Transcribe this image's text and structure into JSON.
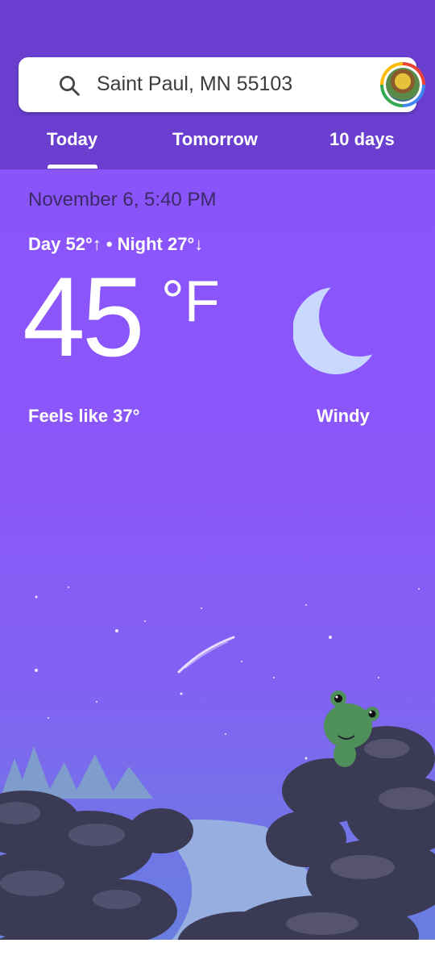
{
  "search": {
    "location": "Saint Paul, MN 55103",
    "icon": "search-icon"
  },
  "avatar": {
    "icon": "account-avatar"
  },
  "tabs": [
    {
      "label": "Today",
      "selected": true
    },
    {
      "label": "Tomorrow",
      "selected": false
    },
    {
      "label": "10 days",
      "selected": false
    }
  ],
  "weather": {
    "datetime": "November 6, 5:40 PM",
    "day_night": "Day 52°↑ • Night 27°↓",
    "temperature": "45",
    "unit": "°F",
    "feels_like": "Feels like 37°",
    "condition": "Windy",
    "condition_icon": "moon-icon"
  },
  "colors": {
    "appbar": "#6a3fd0",
    "background_top": "#8a54fb",
    "background_bottom": "#6680dd",
    "moon": "#c8d8ff"
  }
}
